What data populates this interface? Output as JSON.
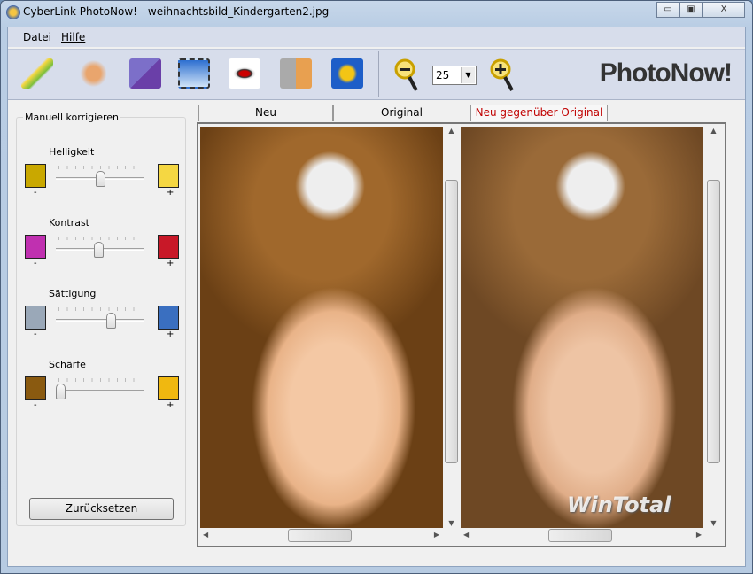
{
  "window": {
    "title": "CyberLink PhotoNow! - weihnachtsbild_Kindergarten2.jpg",
    "minimize": "▭",
    "maximize": "▣",
    "close": "X"
  },
  "menu": [
    {
      "label": "Datei"
    },
    {
      "label": "Hilfe"
    }
  ],
  "toolbar": {
    "tools": [
      "auto-fix-icon",
      "manual-fix-icon",
      "rotate-icon",
      "crop-icon",
      "red-eye-icon",
      "face-icon",
      "export-icon"
    ],
    "zoom_value": "25",
    "brand": "PhotoNow!"
  },
  "panel": {
    "title": "Manuell korrigieren",
    "sliders": [
      {
        "label": "Helligkeit",
        "minus": "-",
        "plus": "+",
        "value": 0.5
      },
      {
        "label": "Kontrast",
        "minus": "-",
        "plus": "+",
        "value": 0.48
      },
      {
        "label": "Sättigung",
        "minus": "-",
        "plus": "+",
        "value": 0.64
      },
      {
        "label": "Schärfe",
        "minus": "-",
        "plus": "+",
        "value": 0.0
      }
    ],
    "reset": "Zurücksetzen"
  },
  "tabs": [
    {
      "label": "Neu"
    },
    {
      "label": "Original"
    },
    {
      "label": "Neu gegenüber Original",
      "active": true
    }
  ],
  "viewer": {
    "watermark": "WinTotal"
  },
  "colors": {
    "active_tab": "#c00000",
    "toolbar": "#d7ddeb"
  }
}
